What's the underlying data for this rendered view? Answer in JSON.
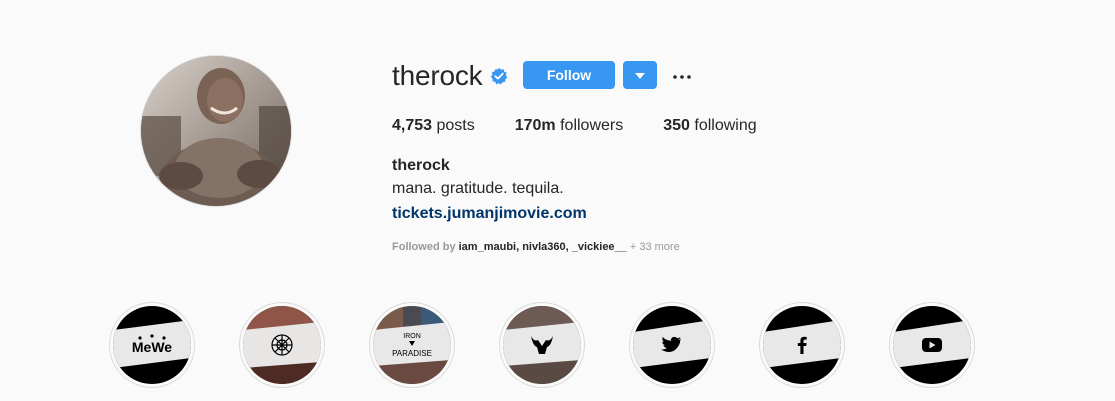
{
  "profile": {
    "username": "therock",
    "verified_icon": "verified-badge-icon",
    "follow_label": "Follow",
    "dropdown_icon": "caret-down-icon",
    "more_icon": "more-options-icon",
    "accent_color": "#3897f0",
    "stats": {
      "posts_count": "4,753",
      "posts_label": " posts",
      "followers_count": "170m",
      "followers_label": " followers",
      "following_count": "350",
      "following_label": " following"
    },
    "full_name": "therock",
    "bio": "mana. gratitude. tequila.",
    "website": "tickets.jumanjimovie.com",
    "followed_by": {
      "prefix": "Followed by ",
      "names": "iam_maubi, nivla360, _vickiee__",
      "more": " + 33 more"
    }
  },
  "highlights": [
    {
      "label": "MeWe",
      "icon": "mewe-logo-icon"
    },
    {
      "label": "",
      "icon": "ornament-logo-icon"
    },
    {
      "label_top": "IRON",
      "label_bottom": "PARADISE",
      "icon": "iron-paradise-logo-icon"
    },
    {
      "label": "",
      "icon": "bull-logo-icon"
    },
    {
      "label": "",
      "icon": "twitter-icon"
    },
    {
      "label": "",
      "icon": "facebook-icon"
    },
    {
      "label": "",
      "icon": "youtube-icon"
    }
  ]
}
